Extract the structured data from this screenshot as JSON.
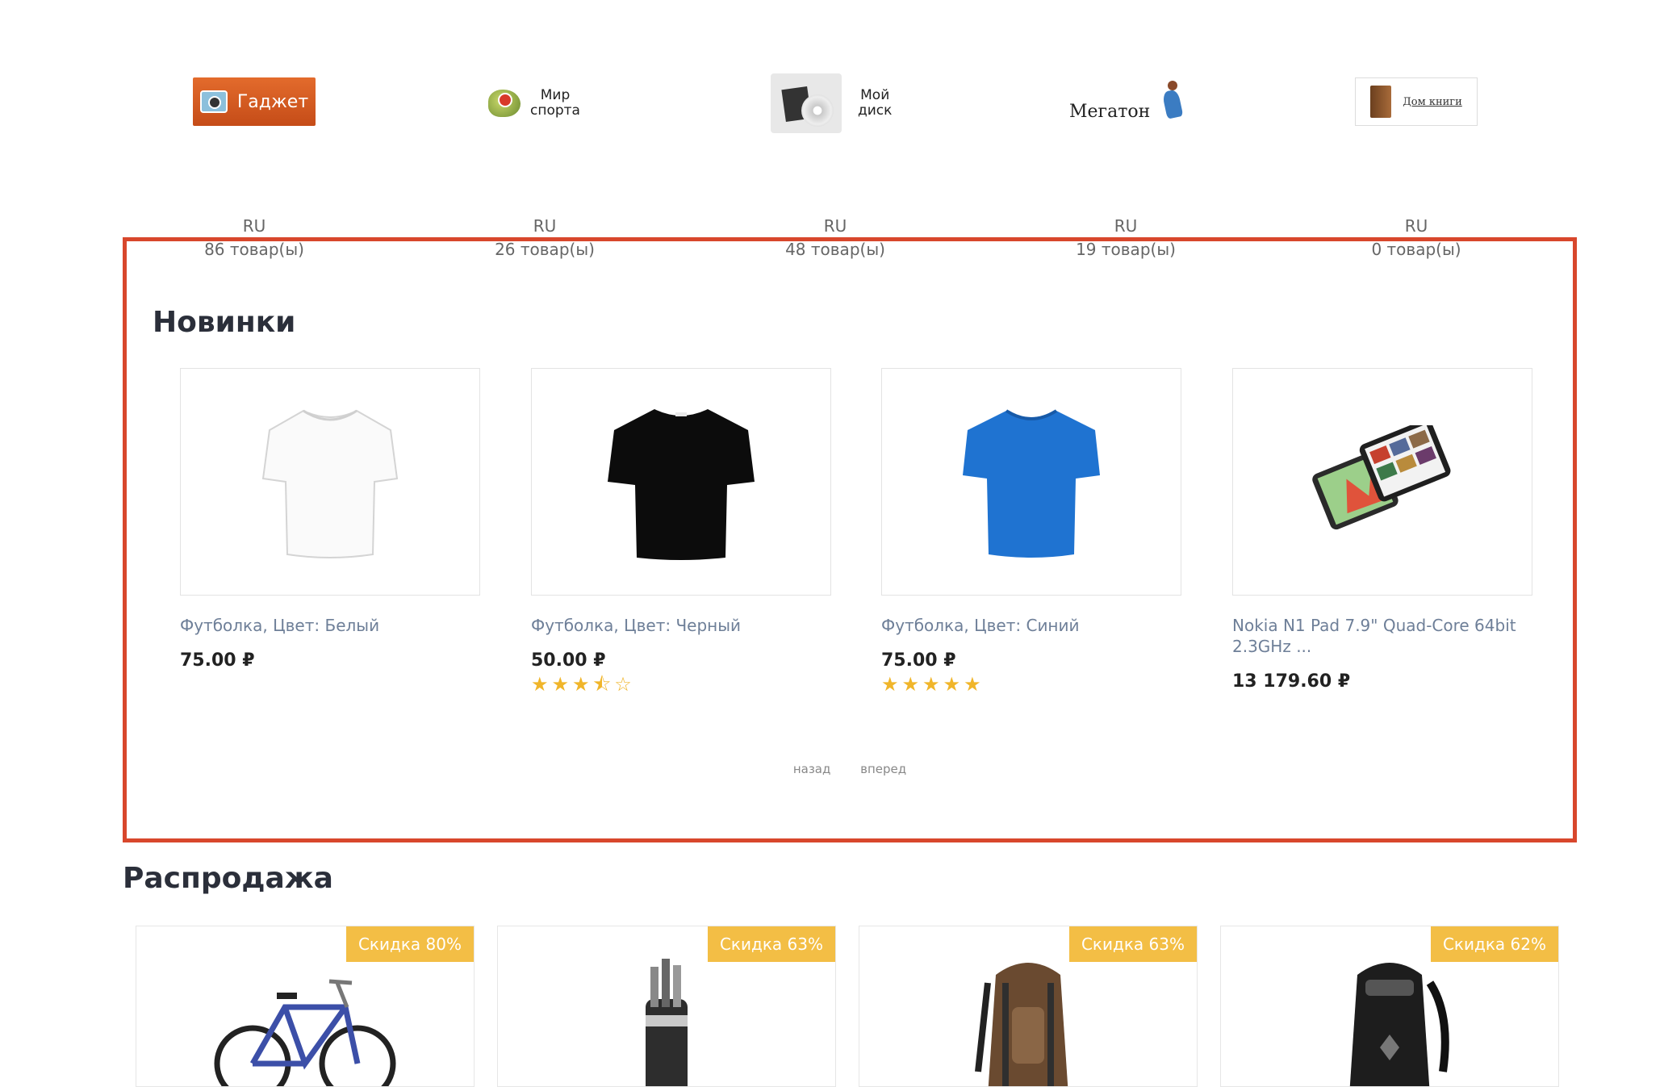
{
  "shops": [
    {
      "logo_text": "Гаджет",
      "region": "RU",
      "count": "86 товар(ы)"
    },
    {
      "logo_text_1": "Мир",
      "logo_text_2": "спорта",
      "region": "RU",
      "count": "26 товар(ы)"
    },
    {
      "logo_text_1": "Мой",
      "logo_text_2": "диск",
      "region": "RU",
      "count": "48 товар(ы)"
    },
    {
      "logo_text": "Мегатон",
      "region": "RU",
      "count": "19 товар(ы)"
    },
    {
      "logo_text": "Дом книги",
      "region": "RU",
      "count": "0 товар(ы)"
    }
  ],
  "new_section": {
    "title": "Новинки",
    "products": [
      {
        "name": "Футболка, Цвет: Белый",
        "price": "75.00 ₽",
        "color": "#ffffff",
        "rating": null
      },
      {
        "name": "Футболка, Цвет: Черный",
        "price": "50.00 ₽",
        "color": "#0c0c0c",
        "rating": 3.5,
        "stars": "★★★⯪☆"
      },
      {
        "name": "Футболка, Цвет: Синий",
        "price": "75.00 ₽",
        "color": "#1f73d1",
        "rating": 5,
        "stars": "★★★★★"
      },
      {
        "name": "Nokia N1 Pad 7.9\" Quad-Core 64bit 2.3GHz ...",
        "price": "13 179.60 ₽",
        "rating": null
      }
    ],
    "pager": {
      "prev": "назад",
      "next": "вперед"
    }
  },
  "sale_section": {
    "title": "Распродажа",
    "items": [
      {
        "badge": "Скидка 80%",
        "kind": "bicycle"
      },
      {
        "badge": "Скидка 63%",
        "kind": "golf-bag"
      },
      {
        "badge": "Скидка 63%",
        "kind": "backpack-brown"
      },
      {
        "badge": "Скидка 62%",
        "kind": "backpack-black"
      }
    ]
  },
  "colors": {
    "accent_border": "#d8472c",
    "badge": "#f3be45",
    "link": "#6e7f98",
    "star": "#f0b52a"
  }
}
